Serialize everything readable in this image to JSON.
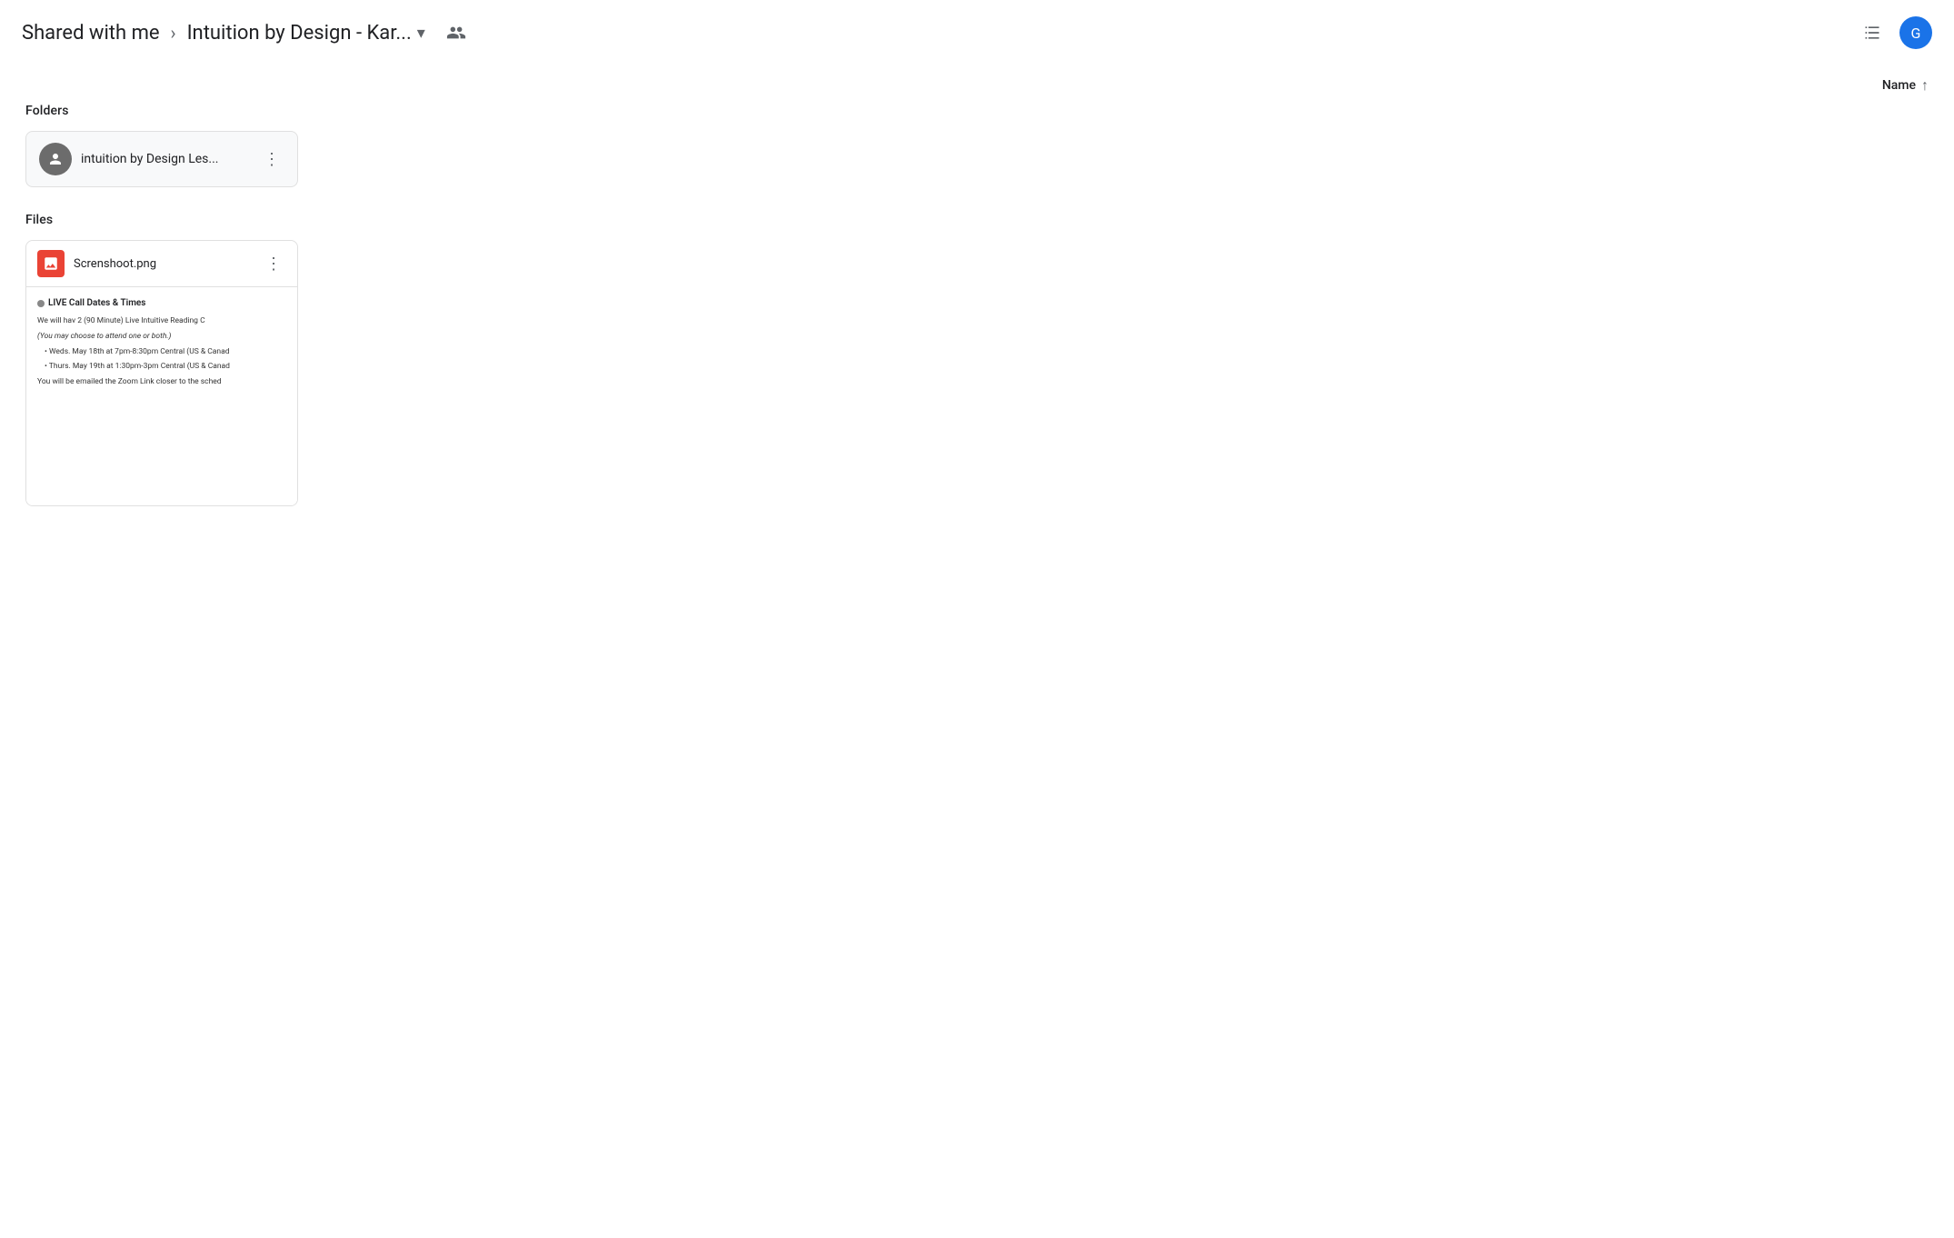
{
  "header": {
    "breadcrumb_shared": "Shared with me",
    "breadcrumb_arrow": "›",
    "breadcrumb_current": "Intuition by Design - Kar...",
    "people_icon": "👥",
    "list_view_icon": "☰",
    "account_letter": "G"
  },
  "sort": {
    "label": "Name",
    "arrow": "↑"
  },
  "folders_label": "Folders",
  "files_label": "Files",
  "folder": {
    "name": "intuition by Design Les...",
    "shared_icon": "👤"
  },
  "file": {
    "name": "Screnshoot.png",
    "type_icon": "image",
    "thumbnail": {
      "title": "LIVE Call Dates & Times",
      "lines": [
        "We will hav 2 (90 Minute) Live Intuitive Reading C",
        "(You may choose to attend one or both.)",
        "• Weds. May 18th at 7pm-8:30pm Central (US & Canad",
        "• Thurs. May 19th at 1:30pm-3pm Central (US & Canad",
        "You will be emailed the Zoom Link closer to the sched"
      ]
    }
  },
  "icons": {
    "chevron_down": "▾",
    "more_vert": "⋮",
    "arrow_up": "↑"
  }
}
